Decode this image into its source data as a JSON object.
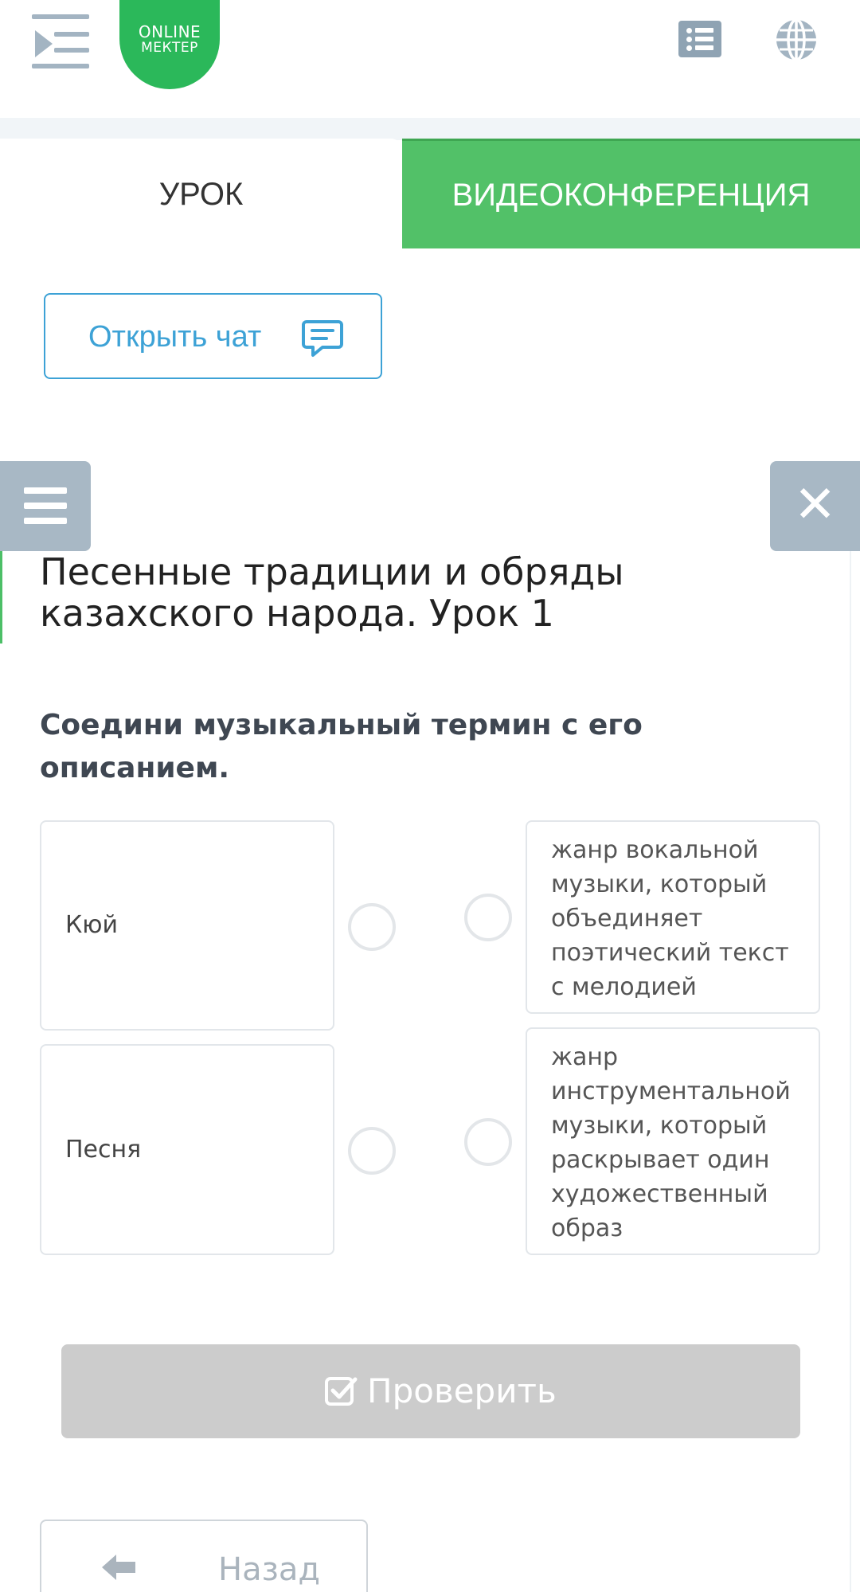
{
  "header": {
    "logo_line1": "ONLINE",
    "logo_line2": "МЕКТЕР",
    "icons": [
      "sidebar-toggle-icon",
      "list-icon",
      "globe-icon"
    ]
  },
  "tabs": [
    {
      "label": "УРОК",
      "active": true
    },
    {
      "label": "ВИДЕОКОНФЕРЕНЦИЯ",
      "active": false
    }
  ],
  "chat_button": {
    "label": "Открыть чат",
    "icon": "chat-icon"
  },
  "side_buttons": {
    "menu_icon": "menu-icon",
    "close_icon": "close-icon",
    "close_glyph": "✕"
  },
  "lesson": {
    "title": "Песенные традиции и обряды казахского народа. Урок 1",
    "question": "Соедини музыкальный термин с его описанием."
  },
  "matching": {
    "terms": [
      "Кюй",
      "Песня"
    ],
    "descriptions": [
      "жанр вокальной музыки, который объединяет поэтический текст с мелодией",
      "жанр инструментальной музыки, который раскрывает один художественный образ"
    ]
  },
  "check_button": {
    "label": "Проверить",
    "icon": "checkbox-icon",
    "enabled": false
  },
  "back_button": {
    "label": "Назад",
    "icon": "arrow-left-icon"
  },
  "colors": {
    "brand_green": "#52c168",
    "chat_blue": "#3da2d6",
    "icon_gray": "#a8b8c5",
    "disabled_gray": "#cccccc"
  }
}
